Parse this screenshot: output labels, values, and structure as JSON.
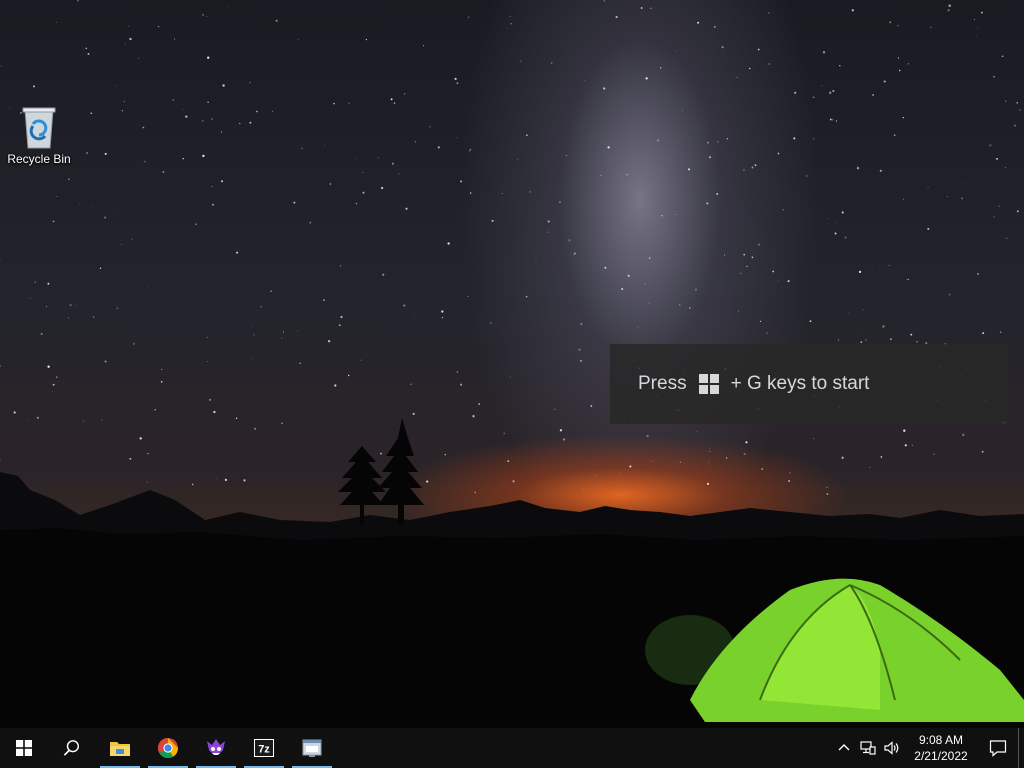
{
  "desktop": {
    "icons": [
      {
        "label": "Recycle Bin",
        "icon": "recycle-bin-icon"
      }
    ]
  },
  "toast": {
    "text_before": "Press",
    "text_after": "+ G keys to start",
    "icon": "windows-logo-icon"
  },
  "taskbar": {
    "start_icon": "windows-logo-icon",
    "search_icon": "search-icon",
    "pinned_apps": [
      {
        "name": "File Explorer",
        "icon": "folder-icon",
        "color": "#f3c43e"
      },
      {
        "name": "Google Chrome",
        "icon": "chrome-icon",
        "color": "#4285f4"
      },
      {
        "name": "App",
        "icon": "purple-creature-icon",
        "color": "#8a44d6"
      },
      {
        "name": "7-Zip",
        "icon": "7zip-icon",
        "color": "#ffffff"
      },
      {
        "name": "App",
        "icon": "window-app-icon",
        "color": "#cfd8e0"
      }
    ],
    "tray": {
      "chevron_icon": "chevron-up-icon",
      "network_icon": "network-icon",
      "volume_icon": "volume-icon",
      "time": "9:08 AM",
      "date": "2/21/2022",
      "notification_icon": "notification-icon"
    }
  },
  "colors": {
    "taskbar_bg": "#101010",
    "pinned_indicator": "#76b9ed",
    "toast_bg": "#282828"
  }
}
